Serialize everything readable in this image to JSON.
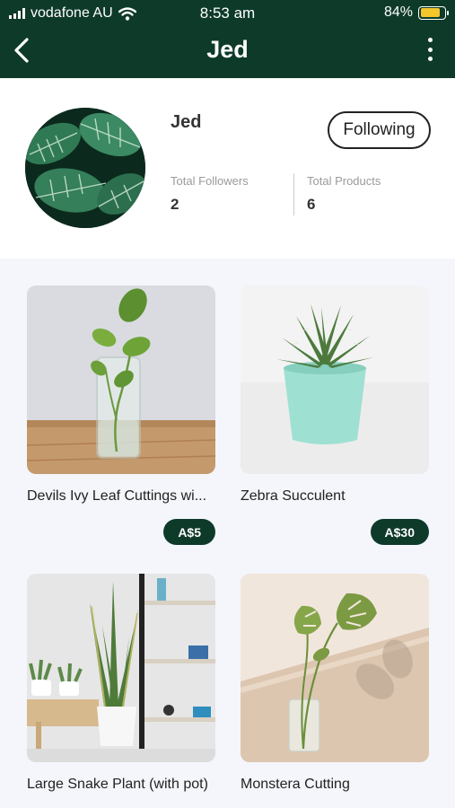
{
  "status_bar": {
    "carrier": "vodafone AU",
    "time": "8:53 am",
    "battery_percent": "84%",
    "battery_level": 0.84,
    "icons": [
      "signal-icon",
      "wifi-icon",
      "battery-icon"
    ]
  },
  "nav": {
    "title": "Jed",
    "back_icon": "chevron-left-icon",
    "more_icon": "more-vertical-icon"
  },
  "profile": {
    "name": "Jed",
    "follow_button": "Following",
    "stats": [
      {
        "label": "Total Followers",
        "value": "2"
      },
      {
        "label": "Total Products",
        "value": "6"
      }
    ]
  },
  "products": [
    {
      "title": "Devils Ivy Leaf Cuttings wi...",
      "price": "A$5"
    },
    {
      "title": "Zebra Succulent",
      "price": "A$30"
    },
    {
      "title": "Large Snake Plant (with pot)",
      "price": ""
    },
    {
      "title": "Monstera Cutting",
      "price": ""
    }
  ],
  "colors": {
    "brand": "#0e3a2a",
    "battery": "#f5c52c",
    "background": "#f4f6fb"
  }
}
